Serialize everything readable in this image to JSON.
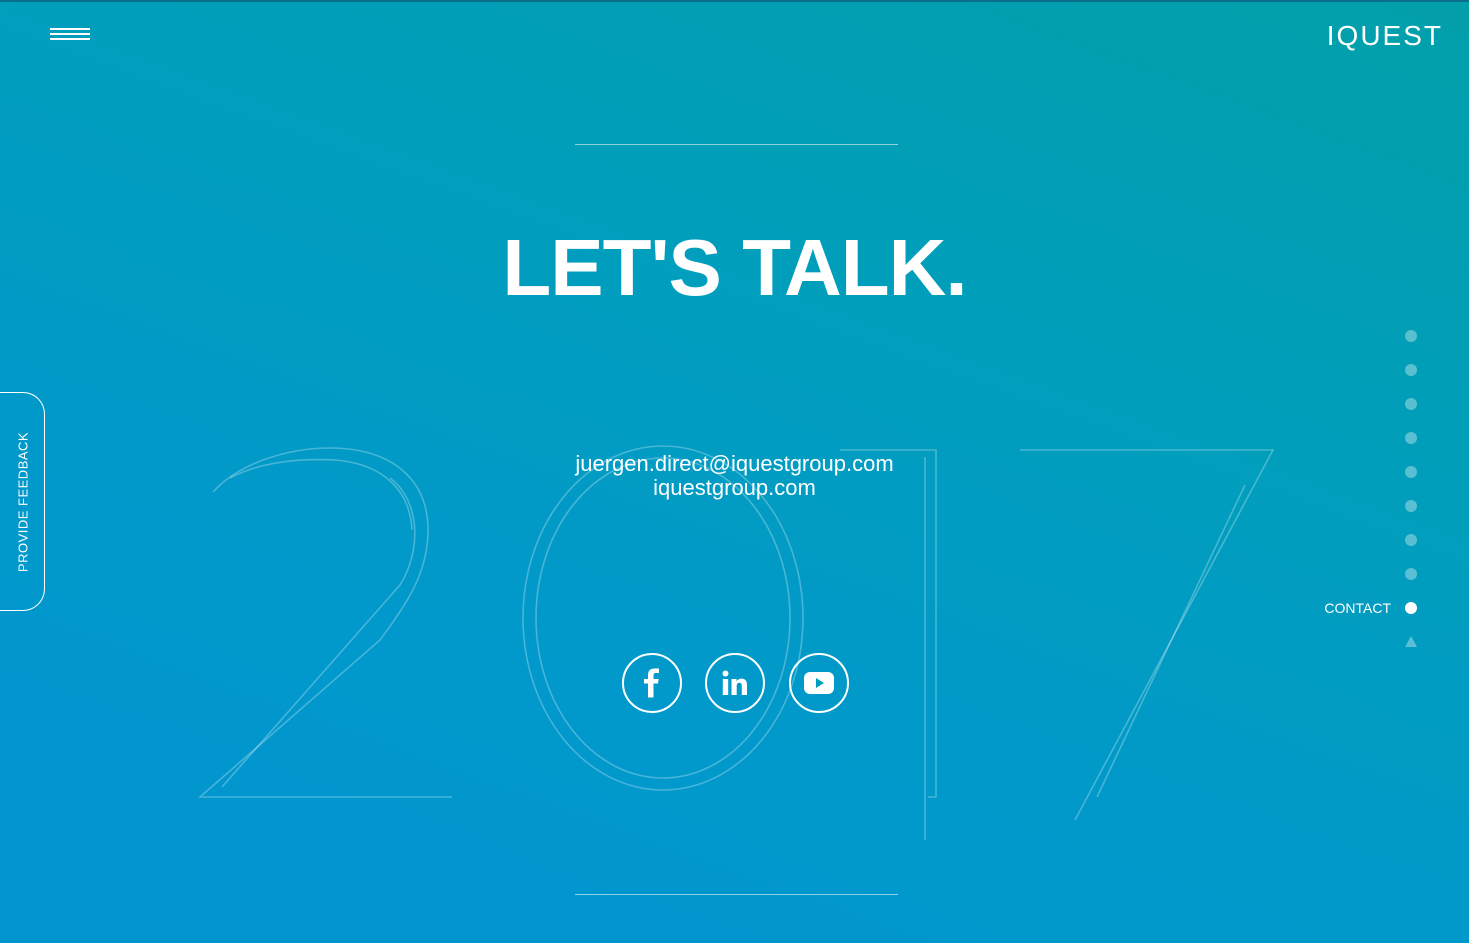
{
  "header": {
    "menu_icon": "hamburger-menu-icon",
    "logo_text": "IQUEST"
  },
  "background": {
    "decorative_year": "2017"
  },
  "main": {
    "headline": "LET'S TALK.",
    "email": "juergen.direct@iquestgroup.com",
    "website": "iquestgroup.com",
    "social_icons": [
      "facebook-icon",
      "linkedin-icon",
      "youtube-icon"
    ]
  },
  "feedback": {
    "label": "PROVIDE FEEDBACK"
  },
  "section_nav": {
    "active_label": "CONTACT",
    "dot_count": 9,
    "active_index": 8,
    "up_icon": "arrow-up-icon"
  },
  "colors": {
    "gradient_top": "#029faa",
    "gradient_bottom": "#0195d0",
    "text": "#ffffff"
  }
}
